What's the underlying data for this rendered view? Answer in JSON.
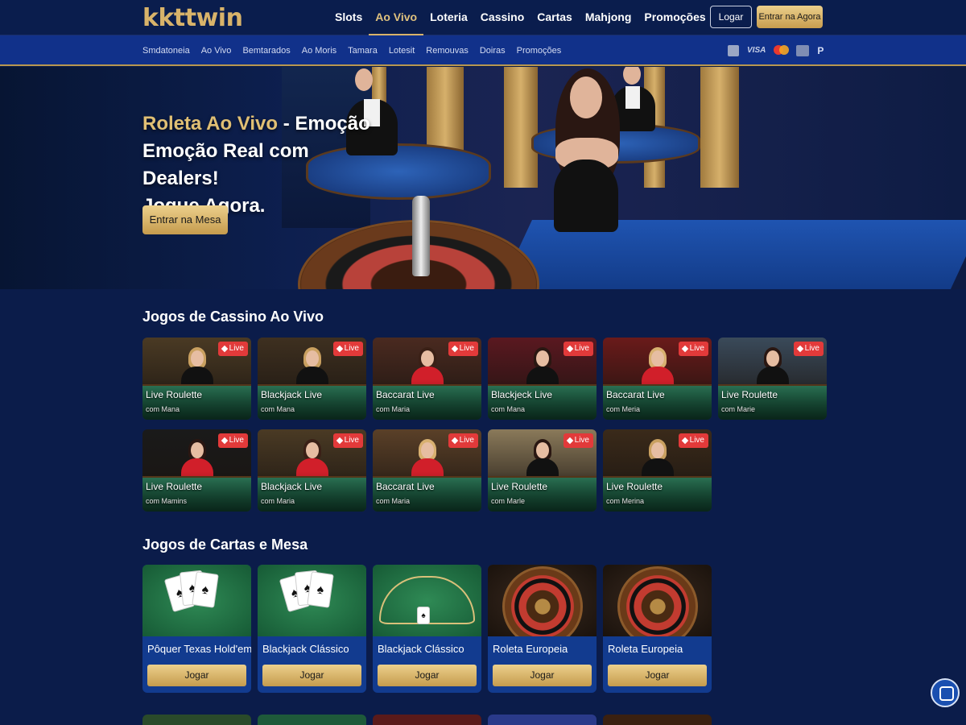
{
  "brand": {
    "logo": "kkttwin"
  },
  "main_nav": [
    {
      "label": "Slots",
      "active": false
    },
    {
      "label": "Ao Vivo",
      "active": true
    },
    {
      "label": "Loteria",
      "active": false
    },
    {
      "label": "Cassino",
      "active": false
    },
    {
      "label": "Cartas",
      "active": false
    },
    {
      "label": "Mahjong",
      "active": false
    },
    {
      "label": "Promoções",
      "active": false
    }
  ],
  "auth": {
    "login_label": "Logar",
    "join_label": "Entrar na Agora"
  },
  "sub_nav": [
    "Smdatoneia",
    "Ao Vivo",
    "Bemtarados",
    "Ao Moris",
    "Tamara",
    "Lotesit",
    "Remouvas",
    "Doiras",
    "Promoções"
  ],
  "payments": [
    "wallet-icon",
    "VISA",
    "mastercard-icon",
    "card-icon",
    "P"
  ],
  "hero": {
    "title_gold": "Roleta Ao Vivo",
    "title_rest": " - Emoção",
    "line2": "Emoção Real com Dealers!",
    "line3": "Jogue Agora.",
    "cta": "Entrar na Mesa"
  },
  "live_section": {
    "title": "Jogos de Cassino Ao Vivo",
    "badge": "Live",
    "games": [
      {
        "name": "Live Roulette",
        "host": "com Mana",
        "outfit": "#111111",
        "hair": "#c9a060",
        "bg": "#4a3a24"
      },
      {
        "name": "Blackjack Live",
        "host": "com Mana",
        "outfit": "#111111",
        "hair": "#c9a060",
        "bg": "#3e3020"
      },
      {
        "name": "Baccarat Live",
        "host": "com Maria",
        "outfit": "#d11f2a",
        "hair": "#3a2016",
        "bg": "#4a2a20"
      },
      {
        "name": "Blackjeck Live",
        "host": "com Mana",
        "outfit": "#111111",
        "hair": "#2a1712",
        "bg": "#5a1820"
      },
      {
        "name": "Baccarat Live",
        "host": "com Meria",
        "outfit": "#d11f2a",
        "hair": "#d8b070",
        "bg": "#6a1a1a"
      },
      {
        "name": "Live Roulette",
        "host": "com Marie",
        "outfit": "#111111",
        "hair": "#2a1712",
        "bg": "#3a4a5a"
      },
      {
        "name": "Live Roulette",
        "host": "com Mamins",
        "outfit": "#d11f2a",
        "hair": "#2a1712",
        "bg": "#1a1a1a"
      },
      {
        "name": "Blackjack Live",
        "host": "com Maria",
        "outfit": "#d11f2a",
        "hair": "#3a2016",
        "bg": "#4a3a24"
      },
      {
        "name": "Baccarat Live",
        "host": "com Maria",
        "outfit": "#d11f2a",
        "hair": "#d8b070",
        "bg": "#5a4028"
      },
      {
        "name": "Live Roulette",
        "host": "com Marle",
        "outfit": "#111111",
        "hair": "#2a1712",
        "bg": "#8a7a5a"
      },
      {
        "name": "Live Roulette",
        "host": "com Merina",
        "outfit": "#111111",
        "hair": "#c9a060",
        "bg": "#3a2a1a"
      }
    ]
  },
  "table_section": {
    "title": "Jogos de Cartas e Mesa",
    "play_label": "Jogar",
    "games": [
      {
        "name": "Pôquer Texas Hold'em",
        "kind": "cards"
      },
      {
        "name": "Blackjack Clássico",
        "kind": "cards"
      },
      {
        "name": "Blackjack Clássico",
        "kind": "table"
      },
      {
        "name": "Roleta Europeia",
        "kind": "wheel"
      },
      {
        "name": "Roleta Europeia",
        "kind": "wheel"
      }
    ]
  },
  "colors": {
    "accent_gold": "#d8b36a",
    "live_red": "#e23a3a",
    "background": "#0b1c4a"
  }
}
